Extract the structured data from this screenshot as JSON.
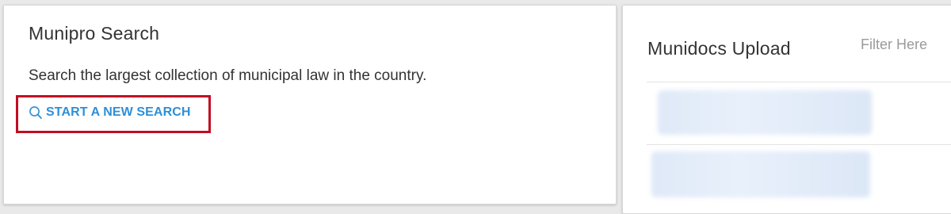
{
  "munipro_card": {
    "title": "Munipro Search",
    "description": "Search the largest collection of municipal law in the country.",
    "search_link": {
      "label": "START A NEW SEARCH",
      "icon": "search-icon",
      "color": "#2e8fd8"
    },
    "highlight_color": "#c10d23"
  },
  "munidocs_card": {
    "title": "Munidocs Upload",
    "filter": {
      "placeholder": "Filter Here",
      "value": ""
    }
  }
}
